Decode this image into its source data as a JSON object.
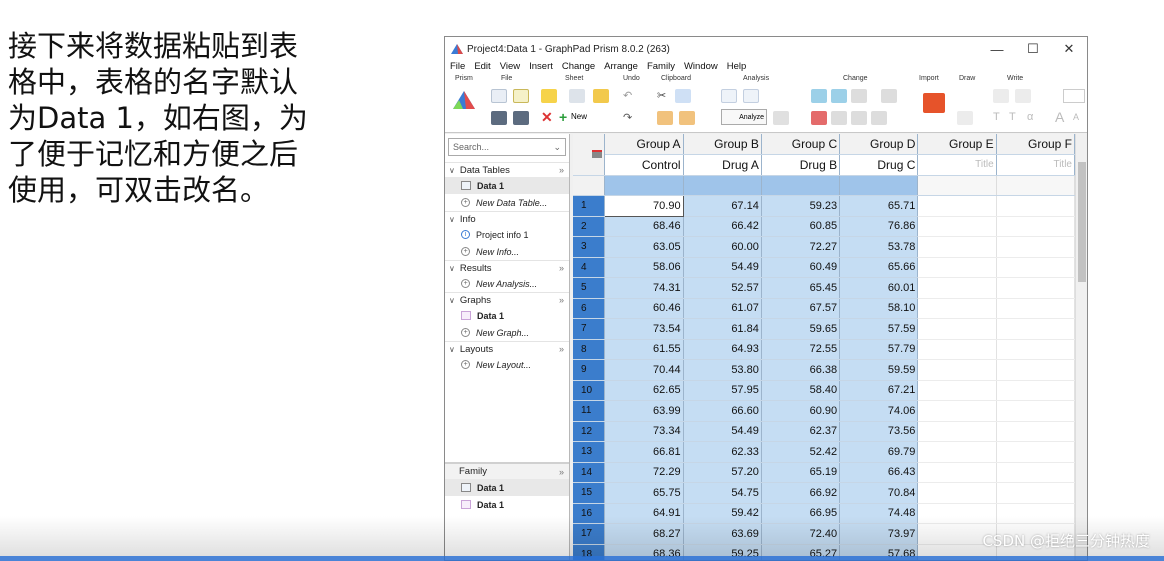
{
  "caption": {
    "lines": [
      "接下来将数据粘贴到表",
      "格中，表格的名字默认",
      "为Data 1，如右图，为",
      "了便于记忆和方便之后",
      "使用，可双击改名。"
    ]
  },
  "window": {
    "title": "Project4:Data 1 - GraphPad Prism 8.0.2 (263)",
    "controls": {
      "minimize": "—",
      "maximize": "☐",
      "close": "✕"
    }
  },
  "menu": [
    "File",
    "Edit",
    "View",
    "Insert",
    "Change",
    "Arrange",
    "Family",
    "Window",
    "Help"
  ],
  "ribbon": {
    "groups": [
      "Prism",
      "File",
      "Sheet",
      "Undo",
      "Clipboard",
      "Analysis",
      "Change",
      "Import",
      "Draw",
      "Write"
    ],
    "new_label": "New",
    "analyze_label": "Analyze"
  },
  "navigator": {
    "search_placeholder": "Search...",
    "sections": [
      {
        "name": "Data Tables",
        "items": [
          {
            "label": "Data 1",
            "selected": true
          },
          {
            "label": "New Data Table...",
            "new": true
          }
        ]
      },
      {
        "name": "Info",
        "items": [
          {
            "label": "Project info 1"
          },
          {
            "label": "New Info...",
            "new": true
          }
        ]
      },
      {
        "name": "Results",
        "items": [
          {
            "label": "New Analysis...",
            "new": true
          }
        ]
      },
      {
        "name": "Graphs",
        "items": [
          {
            "label": "Data 1",
            "bold": true
          },
          {
            "label": "New Graph...",
            "new": true
          }
        ]
      },
      {
        "name": "Layouts",
        "items": [
          {
            "label": "New Layout...",
            "new": true
          }
        ]
      }
    ],
    "family": {
      "name": "Family",
      "items": [
        "Data 1",
        "Data 1"
      ]
    }
  },
  "table": {
    "group_headers": [
      "Group A",
      "Group B",
      "Group C",
      "Group D",
      "Group E",
      "Group F"
    ],
    "titles": [
      "Control",
      "Drug A",
      "Drug B",
      "Drug C",
      "Title",
      "Title"
    ],
    "rows": [
      [
        "70.90",
        "67.14",
        "59.23",
        "65.71"
      ],
      [
        "68.46",
        "66.42",
        "60.85",
        "76.86"
      ],
      [
        "63.05",
        "60.00",
        "72.27",
        "53.78"
      ],
      [
        "58.06",
        "54.49",
        "60.49",
        "65.66"
      ],
      [
        "74.31",
        "52.57",
        "65.45",
        "60.01"
      ],
      [
        "60.46",
        "61.07",
        "67.57",
        "58.10"
      ],
      [
        "73.54",
        "61.84",
        "59.65",
        "57.59"
      ],
      [
        "61.55",
        "64.93",
        "72.55",
        "57.79"
      ],
      [
        "70.44",
        "53.80",
        "66.38",
        "59.59"
      ],
      [
        "62.65",
        "57.95",
        "58.40",
        "67.21"
      ],
      [
        "63.99",
        "66.60",
        "60.90",
        "74.06"
      ],
      [
        "73.34",
        "54.49",
        "62.37",
        "73.56"
      ],
      [
        "66.81",
        "62.33",
        "52.42",
        "69.79"
      ],
      [
        "72.29",
        "57.20",
        "65.19",
        "66.43"
      ],
      [
        "65.75",
        "54.75",
        "66.92",
        "70.84"
      ],
      [
        "64.91",
        "59.42",
        "66.95",
        "74.48"
      ],
      [
        "68.27",
        "63.69",
        "72.40",
        "73.97"
      ],
      [
        "68.36",
        "59.25",
        "65.27",
        "57.68"
      ]
    ],
    "row_numbers": [
      "1",
      "2",
      "3",
      "4",
      "5",
      "6",
      "7",
      "8",
      "9",
      "10",
      "11",
      "12",
      "13",
      "14",
      "15",
      "16",
      "17",
      "18"
    ]
  },
  "watermark": "CSDN @拒绝三分钟热度",
  "colors": {
    "row_header": "#3b7dcc",
    "cell_selected": "#c5ddf3",
    "subheader": "#9fc4ea"
  }
}
